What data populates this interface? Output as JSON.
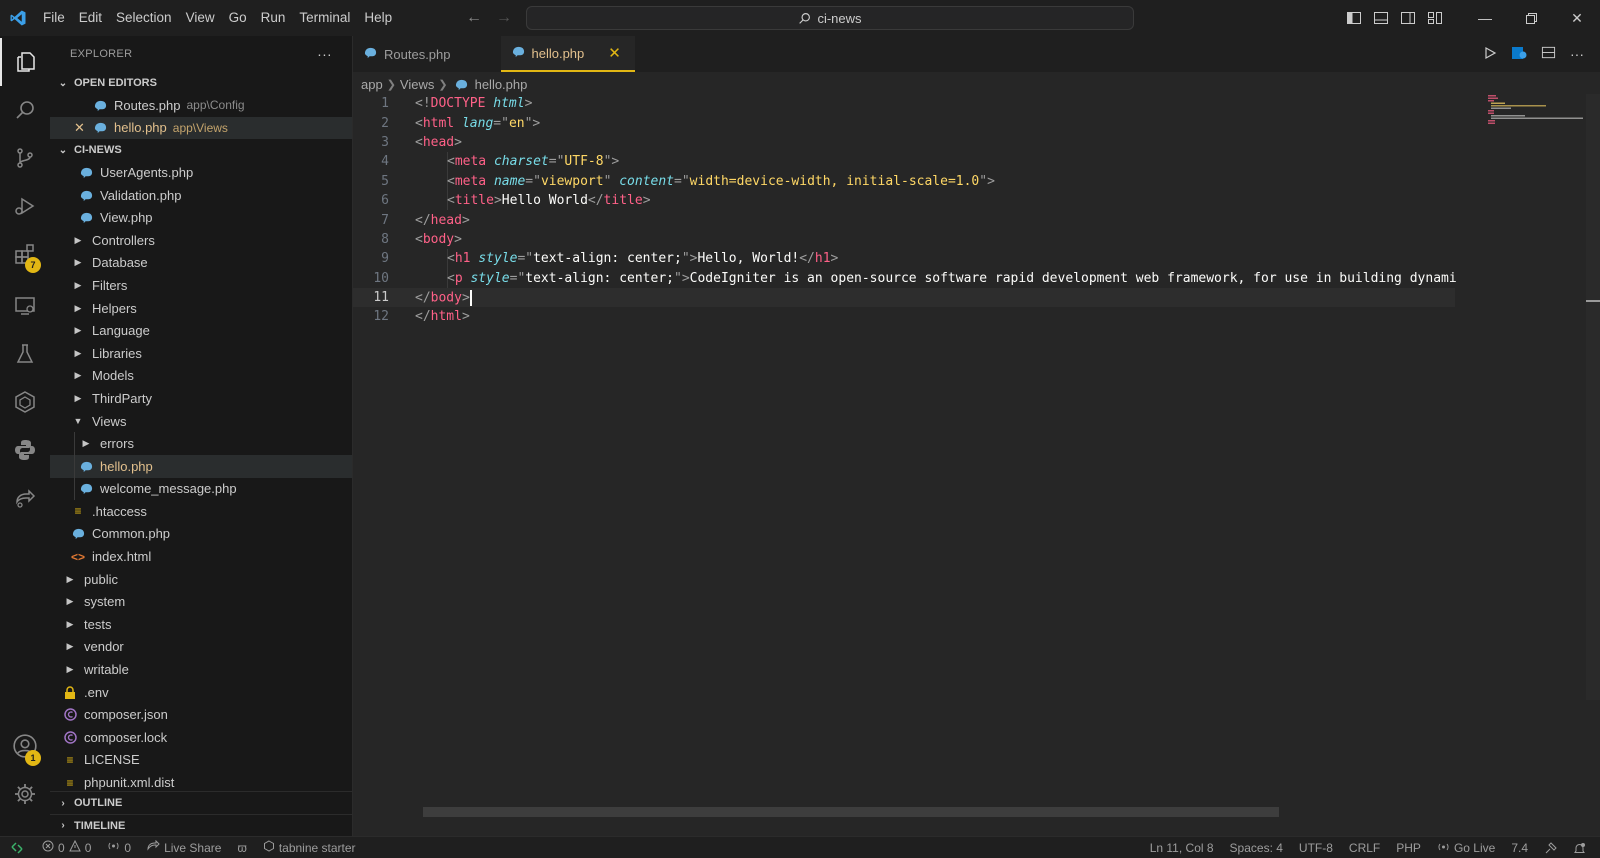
{
  "titlebar": {
    "menu": [
      "File",
      "Edit",
      "Selection",
      "View",
      "Go",
      "Run",
      "Terminal",
      "Help"
    ],
    "search_text": "ci-news",
    "colors": {
      "accent": "#e2b714",
      "logo": "#0a7acc"
    }
  },
  "activitybar": {
    "icons": [
      "explorer-icon",
      "search-icon",
      "source-control-icon",
      "run-debug-icon",
      "extensions-icon",
      "remote-explorer-icon",
      "testing-icon",
      "codeigniter-icon",
      "python-icon",
      "live-share-icon",
      "accounts-icon",
      "gear-icon"
    ],
    "extensions_badge": "7",
    "accounts_badge": "1"
  },
  "sidebar": {
    "title": "EXPLORER",
    "more": "···",
    "open_editors": {
      "header": "OPEN EDITORS",
      "items": [
        {
          "name": "Routes.php",
          "desc": "app\\Config"
        },
        {
          "name": "hello.php",
          "desc": "app\\Views"
        }
      ]
    },
    "project": {
      "header": "CI-NEWS",
      "items": [
        {
          "name": "UserAgents.php"
        },
        {
          "name": "Validation.php"
        },
        {
          "name": "View.php"
        },
        {
          "name": "Controllers"
        },
        {
          "name": "Database"
        },
        {
          "name": "Filters"
        },
        {
          "name": "Helpers"
        },
        {
          "name": "Language"
        },
        {
          "name": "Libraries"
        },
        {
          "name": "Models"
        },
        {
          "name": "ThirdParty"
        },
        {
          "name": "Views"
        },
        {
          "name": "errors"
        },
        {
          "name": "hello.php"
        },
        {
          "name": "welcome_message.php"
        },
        {
          "name": ".htaccess"
        },
        {
          "name": "Common.php"
        },
        {
          "name": "index.html"
        },
        {
          "name": "public"
        },
        {
          "name": "system"
        },
        {
          "name": "tests"
        },
        {
          "name": "vendor"
        },
        {
          "name": "writable"
        },
        {
          "name": ".env"
        },
        {
          "name": "composer.json"
        },
        {
          "name": "composer.lock"
        },
        {
          "name": "LICENSE"
        },
        {
          "name": "phpunit.xml.dist"
        }
      ]
    },
    "outline": "OUTLINE",
    "timeline": "TIMELINE"
  },
  "editor": {
    "tabs": [
      {
        "label": "Routes.php"
      },
      {
        "label": "hello.php"
      }
    ],
    "breadcrumb": [
      "app",
      "Views",
      "hello.php"
    ],
    "line_numbers": [
      "1",
      "2",
      "3",
      "4",
      "5",
      "6",
      "7",
      "8",
      "9",
      "10",
      "11",
      "12"
    ],
    "code": {
      "l1": {
        "a": "<!",
        "b": "DOCTYPE",
        "c": " ",
        "d": "html",
        "e": ">"
      },
      "l2": {
        "a": "<",
        "b": "html",
        "c": " ",
        "d": "lang",
        "e": "=\"",
        "f": "en",
        "g": "\">"
      },
      "l3": {
        "a": "<",
        "b": "head",
        "c": ">"
      },
      "l4": {
        "a": "<",
        "b": "meta",
        "c": " ",
        "d": "charset",
        "e": "=\"",
        "f": "UTF-8",
        "g": "\">"
      },
      "l5": {
        "a": "<",
        "b": "meta",
        "c": " ",
        "d": "name",
        "e": "=\"",
        "f": "viewport",
        "g": "\" ",
        "h": "content",
        "i": "=\"",
        "j": "width=device-width, initial-scale=1.0",
        "k": "\">"
      },
      "l6": {
        "a": "<",
        "b": "title",
        "c": ">",
        "d": "Hello World",
        "e": "</",
        "f": "title",
        "g": ">"
      },
      "l7": {
        "a": "</",
        "b": "head",
        "c": ">"
      },
      "l8": {
        "a": "<",
        "b": "body",
        "c": ">"
      },
      "l9": {
        "a": "<",
        "b": "h1",
        "c": " ",
        "d": "style",
        "e": "=\"",
        "f": "text-align: center;",
        "g": "\">",
        "h": "Hello, World!",
        "i": "</",
        "j": "h1",
        "k": ">"
      },
      "l10": {
        "a": "<",
        "b": "p",
        "c": " ",
        "d": "style",
        "e": "=\"",
        "f": "text-align: center;",
        "g": "\">",
        "h": "CodeIgniter is an open-source software rapid development web framework, for use in building dynami"
      },
      "l11": {
        "a": "</",
        "b": "body",
        "c": ">"
      },
      "l12": {
        "a": "</",
        "b": "html",
        "c": ">"
      }
    }
  },
  "statusbar": {
    "errors": "0",
    "warnings": "0",
    "ports": "0",
    "live_share": "Live Share",
    "tabnine": "tabnine starter",
    "position": "Ln 11, Col 8",
    "spaces": "Spaces: 4",
    "encoding": "UTF-8",
    "eol": "CRLF",
    "language": "PHP",
    "go_live": "Go Live",
    "php_version": "7.4"
  }
}
